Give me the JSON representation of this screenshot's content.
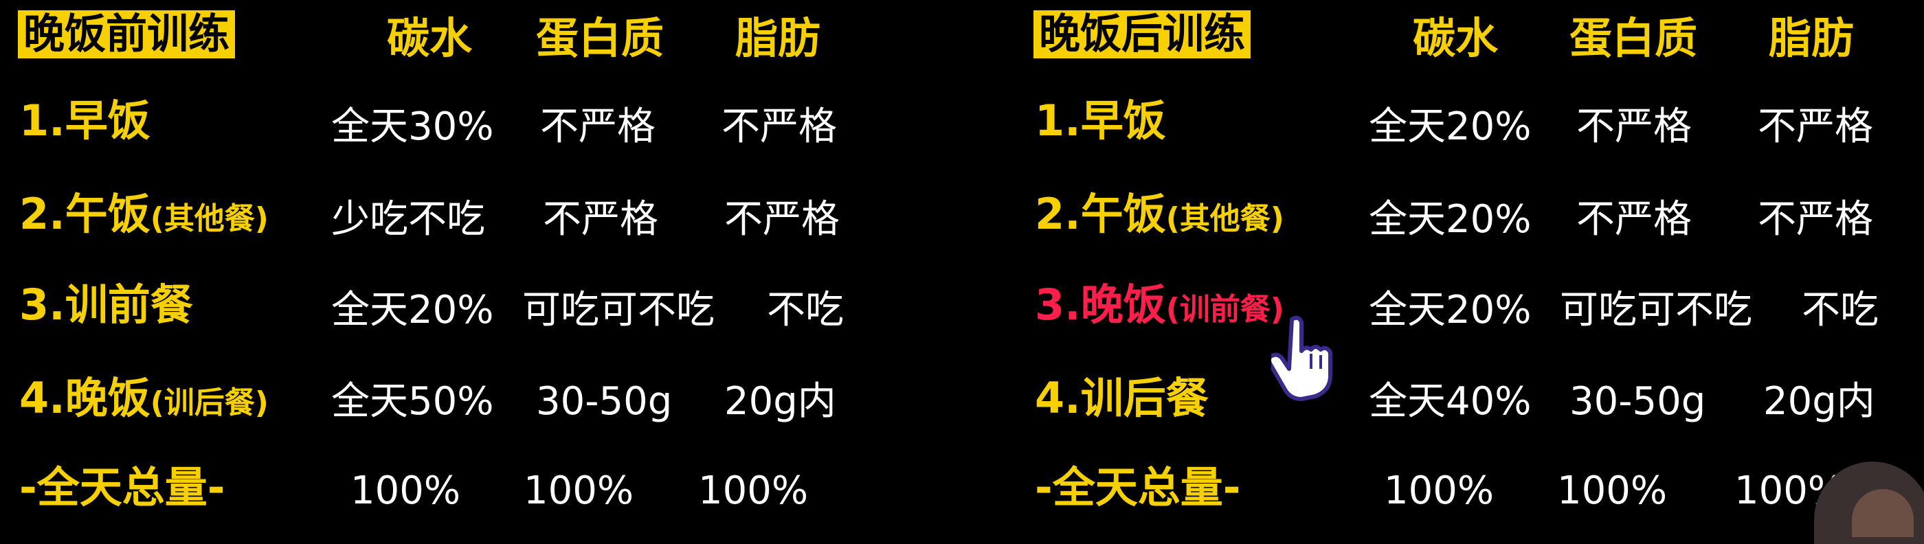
{
  "left": {
    "title": "晚饭前训练",
    "headers": [
      "碳水",
      "蛋白质",
      "脂肪"
    ],
    "rows": [
      {
        "label": "1.早饭",
        "sub": "",
        "cells": [
          "全天30%",
          "不严格",
          "不严格"
        ]
      },
      {
        "label": "2.午饭",
        "sub": "(其他餐)",
        "cells": [
          "少吃不吃",
          "不严格",
          "不严格"
        ]
      },
      {
        "label": "3.训前餐",
        "sub": "",
        "cells": [
          "全天20%",
          "可吃可不吃",
          "不吃"
        ]
      },
      {
        "label": "4.晚饭",
        "sub": "(训后餐)",
        "cells": [
          "全天50%",
          "30-50g",
          "20g内"
        ]
      },
      {
        "label": "-全天总量-",
        "sub": "",
        "cells": [
          "100%",
          "100%",
          "100%"
        ]
      }
    ]
  },
  "right": {
    "title": "晚饭后训练",
    "headers": [
      "碳水",
      "蛋白质",
      "脂肪"
    ],
    "rows": [
      {
        "label": "1.早饭",
        "sub": "",
        "cells": [
          "全天20%",
          "不严格",
          "不严格"
        ]
      },
      {
        "label": "2.午饭",
        "sub": "(其他餐)",
        "cells": [
          "全天20%",
          "不严格",
          "不严格"
        ]
      },
      {
        "label": "3.晚饭",
        "sub": "(训前餐)",
        "cells": [
          "全天20%",
          "可吃可不吃",
          "不吃"
        ]
      },
      {
        "label": "4.训后餐",
        "sub": "",
        "cells": [
          "全天40%",
          "30-50g",
          "20g内"
        ]
      },
      {
        "label": "-全天总量-",
        "sub": "",
        "cells": [
          "100%",
          "100%",
          "100%"
        ]
      }
    ]
  },
  "colors": {
    "accent": "#f6d000",
    "highlight": "#ff1f4a",
    "text": "#ffffff",
    "background": "#000000"
  },
  "icons": {
    "cursor": "hand-pointer-icon"
  }
}
